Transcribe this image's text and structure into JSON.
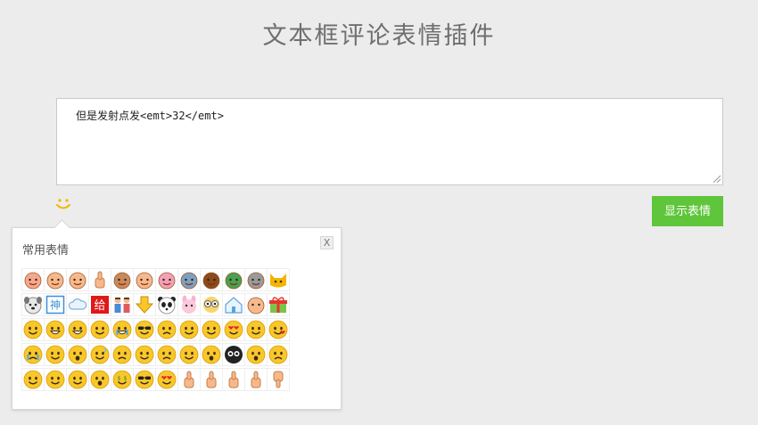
{
  "page": {
    "title": "文本框评论表情插件"
  },
  "editor": {
    "value": "但是发射点发<emt>32</emt>"
  },
  "toolbar": {
    "show_label": "显示表情"
  },
  "panel": {
    "title": "常用表情",
    "close_label": "X",
    "emoticons": [
      [
        "emoticon-face-1",
        "emoticon-face-2",
        "emoticon-face-3",
        "emoticon-hand-wave",
        "emoticon-face-4",
        "emoticon-face-5",
        "emoticon-face-6",
        "emoticon-face-7",
        "emoticon-face-8",
        "emoticon-face-9",
        "emoticon-face-10",
        "emoticon-cat"
      ],
      [
        "emoticon-dog",
        "emoticon-shen",
        "emoticon-cloud",
        "emoticon-gei",
        "emoticon-family",
        "emoticon-down-arrow",
        "emoticon-panda",
        "emoticon-rabbit",
        "emoticon-glasses",
        "emoticon-house",
        "emoticon-face-11",
        "emoticon-gift"
      ],
      [
        "emoticon-smile",
        "emoticon-grin",
        "emoticon-laugh",
        "emoticon-blush",
        "emoticon-happy-tears",
        "emoticon-cool",
        "emoticon-worried",
        "emoticon-smirk",
        "emoticon-wink",
        "emoticon-love",
        "emoticon-hug",
        "emoticon-kiss"
      ],
      [
        "emoticon-cry",
        "emoticon-think",
        "emoticon-shocked",
        "emoticon-sweat",
        "emoticon-angry",
        "emoticon-sly",
        "emoticon-mad",
        "emoticon-dizzy",
        "emoticon-surprised",
        "emoticon-black-face",
        "emoticon-hush",
        "emoticon-sad"
      ],
      [
        "emoticon-embarrassed",
        "emoticon-doubt",
        "emoticon-injured",
        "emoticon-yawn",
        "emoticon-money",
        "emoticon-sunglasses",
        "emoticon-heart-eyes",
        "emoticon-ok-hand",
        "emoticon-thumbs-up",
        "emoticon-yeah",
        "emoticon-pointing-up",
        "emoticon-thumbs-down"
      ]
    ]
  },
  "colors": {
    "accent": "#5fc53a",
    "background": "#ececec",
    "title": "#6f6f6f"
  }
}
